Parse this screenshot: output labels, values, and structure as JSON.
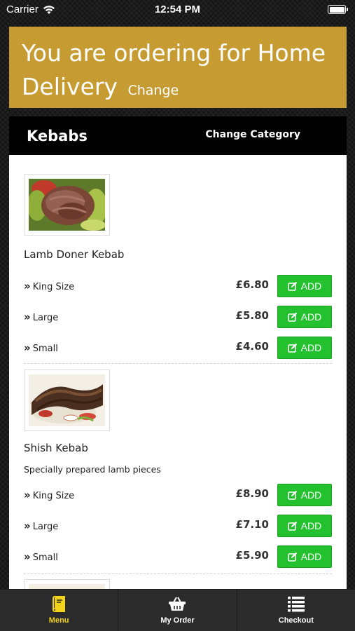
{
  "status_bar": {
    "carrier": "Carrier",
    "time": "12:54 PM"
  },
  "banner": {
    "text": "You are ordering for Home Delivery",
    "change_label": "Change"
  },
  "category": {
    "title": "Kebabs",
    "change_label": "Change Category"
  },
  "items": [
    {
      "name": "Lamb Doner Kebab",
      "description": "",
      "variants": [
        {
          "label": "King Size",
          "price": "£6.80",
          "button": "ADD"
        },
        {
          "label": "Large",
          "price": "£5.80",
          "button": "ADD"
        },
        {
          "label": "Small",
          "price": "£4.60",
          "button": "ADD"
        }
      ]
    },
    {
      "name": "Shish Kebab",
      "description": "Specially prepared lamb pieces",
      "variants": [
        {
          "label": "King Size",
          "price": "£8.90",
          "button": "ADD"
        },
        {
          "label": "Large",
          "price": "£7.10",
          "button": "ADD"
        },
        {
          "label": "Small",
          "price": "£5.90",
          "button": "ADD"
        }
      ]
    }
  ],
  "tabs": [
    {
      "label": "Menu",
      "icon": "menu-book-icon",
      "active": true
    },
    {
      "label": "My Order",
      "icon": "basket-icon",
      "active": false
    },
    {
      "label": "Checkout",
      "icon": "list-icon",
      "active": false
    }
  ],
  "colors": {
    "banner": "#c69b31",
    "add_button": "#22c12d",
    "active_tab": "#f2d21b"
  }
}
